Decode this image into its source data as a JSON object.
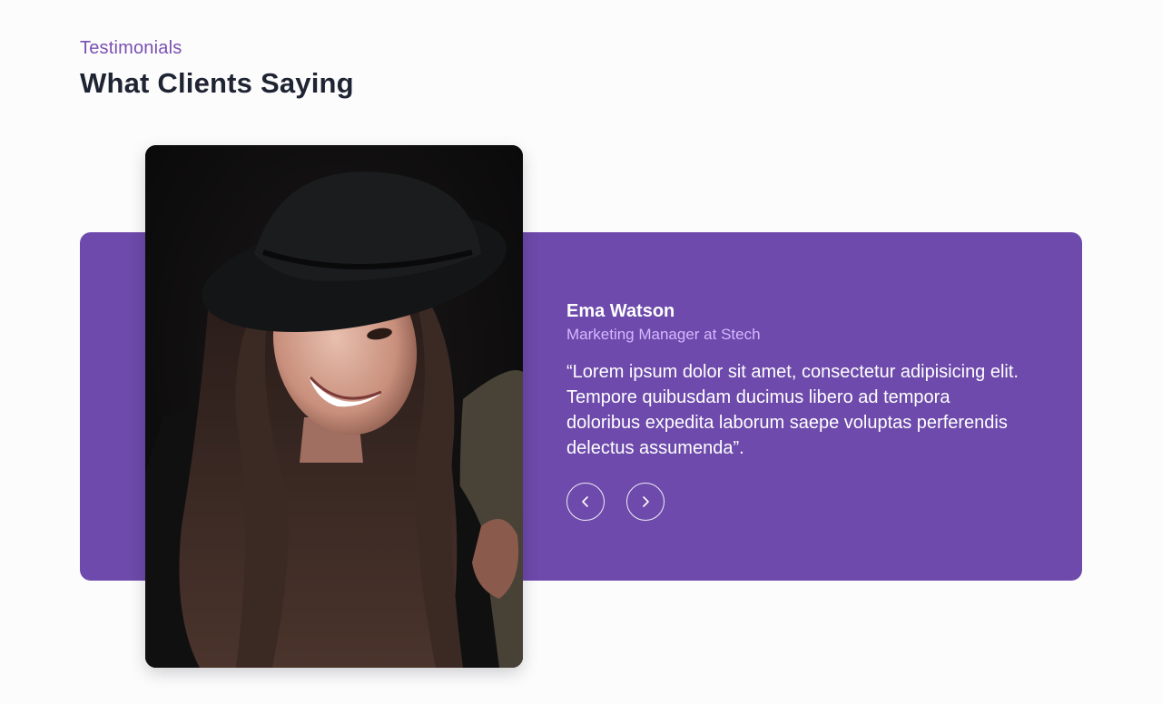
{
  "section": {
    "eyebrow": "Testimonials",
    "title": "What Clients Saying"
  },
  "testimonial": {
    "name": "Ema Watson",
    "role": "Marketing Manager at Stech",
    "quote": "“Lorem ipsum dolor sit amet, consectetur adipisicing elit. Tempore quibusdam ducimus libero ad tempora doloribus expedita laborum saepe voluptas perferendis delectus assumenda”."
  },
  "navigation": {
    "prev_icon": "chevron-left-icon",
    "next_icon": "chevron-right-icon"
  },
  "colors": {
    "accent": "#6d4aab",
    "eyebrow": "#7a4fb0",
    "heading": "#1f2433",
    "role": "#d4b8ff"
  }
}
